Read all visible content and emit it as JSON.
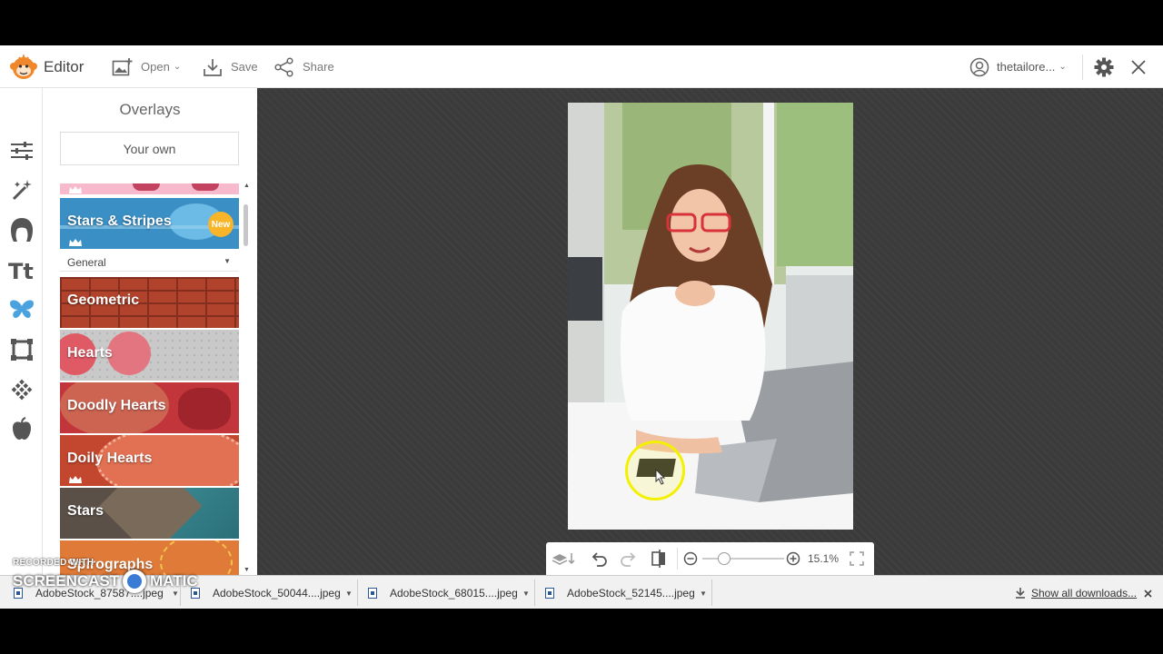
{
  "app": {
    "title": "Editor",
    "brand_color": "#f0872b"
  },
  "toolbar": {
    "open_label": "Open",
    "save_label": "Save",
    "share_label": "Share",
    "username": "thetailore...",
    "icons": [
      "monkey-logo-icon",
      "add-photo-icon",
      "save-icon",
      "share-icon",
      "user-icon",
      "gear-icon",
      "close-icon"
    ]
  },
  "tools_sidebar": {
    "items": [
      {
        "icon": "sliders-icon",
        "active": false
      },
      {
        "icon": "magic-wand-icon",
        "active": false
      },
      {
        "icon": "face-icon",
        "active": false
      },
      {
        "icon": "text-icon",
        "active": false
      },
      {
        "icon": "butterfly-icon",
        "active": true
      },
      {
        "icon": "frame-icon",
        "active": false
      },
      {
        "icon": "texture-icon",
        "active": false
      },
      {
        "icon": "apple-icon",
        "active": false
      }
    ],
    "accent_color": "#4aa3df"
  },
  "panel": {
    "title": "Overlays",
    "your_own_label": "Your own",
    "category": "General",
    "featured": {
      "label": "Stars & Stripes",
      "badge": "New"
    },
    "overlays": [
      {
        "label": "Geometric"
      },
      {
        "label": "Hearts"
      },
      {
        "label": "Doodly Hearts"
      },
      {
        "label": "Doily Hearts"
      },
      {
        "label": "Stars"
      },
      {
        "label": "Spirographs"
      }
    ]
  },
  "zoom": {
    "value": "15.1%",
    "slider_fraction": 0.27
  },
  "downloads": {
    "items": [
      {
        "name": "AdobeStock_87587....jpeg"
      },
      {
        "name": "AdobeStock_50044....jpeg"
      },
      {
        "name": "AdobeStock_68015....jpeg"
      },
      {
        "name": "AdobeStock_52145....jpeg"
      }
    ],
    "show_all_label": "Show all downloads..."
  },
  "watermark": {
    "line1": "RECORDED WITH",
    "line2": "SCREENCAST",
    "line3": "MATIC"
  }
}
